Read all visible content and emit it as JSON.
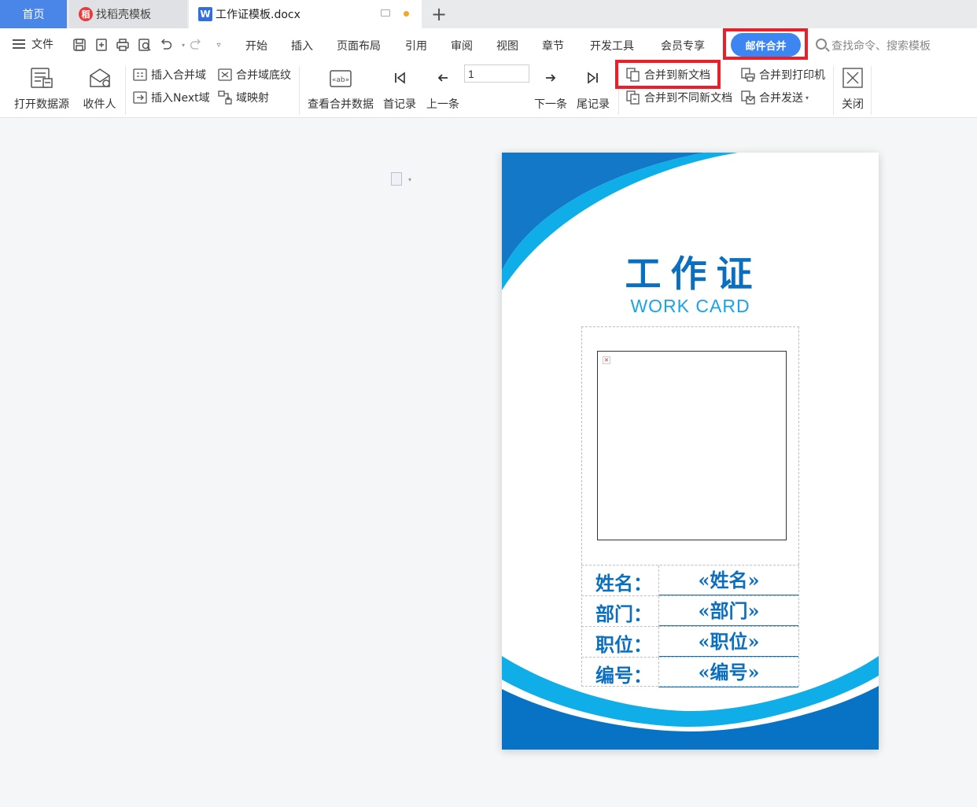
{
  "tabs": {
    "home": "首页",
    "template_store": "找稻壳模板",
    "document": "工作证模板.docx"
  },
  "menu": {
    "file": "文件",
    "tabs": [
      "开始",
      "插入",
      "页面布局",
      "引用",
      "审阅",
      "视图",
      "章节",
      "开发工具",
      "会员专享"
    ],
    "active_tab": "邮件合并",
    "search_placeholder": "查找命令、搜索模板"
  },
  "ribbon": {
    "open_datasource": "打开数据源",
    "recipients": "收件人",
    "insert_merge_field": "插入合并域",
    "merge_field_shading": "合并域底纹",
    "insert_next_field": "插入Next域",
    "field_mapping": "域映射",
    "view_merged_data": "查看合并数据",
    "first_record": "首记录",
    "prev_record": "上一条",
    "record_value": "1",
    "next_record": "下一条",
    "last_record": "尾记录",
    "merge_to_new_doc": "合并到新文档",
    "merge_to_separate_docs": "合并到不同新文档",
    "merge_to_printer": "合并到打印机",
    "merge_send": "合并发送",
    "close": "关闭"
  },
  "card": {
    "title_cn": "工作证",
    "title_en": "WORK CARD",
    "fields": [
      {
        "label": "姓名：",
        "value": "«姓名»"
      },
      {
        "label": "部门：",
        "value": "«部门»"
      },
      {
        "label": "职位：",
        "value": "«职位»"
      },
      {
        "label": "编号：",
        "value": "«编号»"
      }
    ]
  },
  "colors": {
    "accent": "#3d85f0",
    "highlight_box": "#e8202a",
    "card_blue": "#0b6fc0",
    "card_light_blue": "#1aa3e6"
  }
}
